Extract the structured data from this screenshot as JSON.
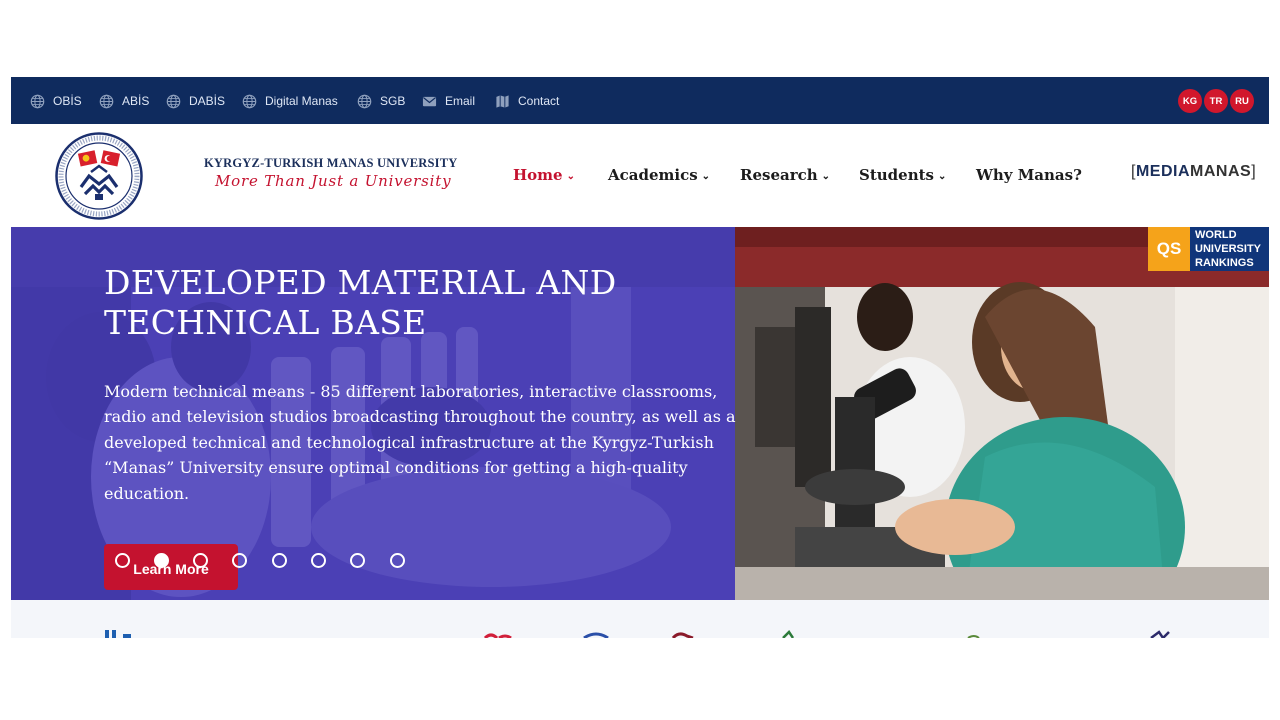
{
  "topbar": {
    "links": [
      {
        "label": "OBİS",
        "icon": "globe-icon"
      },
      {
        "label": "ABİS",
        "icon": "globe-icon"
      },
      {
        "label": "DABİS",
        "icon": "globe-icon"
      },
      {
        "label": "Digital Manas",
        "icon": "globe-icon"
      },
      {
        "label": "SGB",
        "icon": "globe-icon"
      },
      {
        "label": "Email",
        "icon": "envelope-icon"
      },
      {
        "label": "Contact",
        "icon": "map-icon"
      }
    ],
    "languages": [
      "KG",
      "TR",
      "RU"
    ]
  },
  "header": {
    "university_name": "KYRGYZ-TURKISH MANAS UNIVERSITY",
    "slogan": "More Than Just a University",
    "nav": [
      {
        "label": "Home",
        "active": true,
        "dropdown": true
      },
      {
        "label": "Academics",
        "active": false,
        "dropdown": true
      },
      {
        "label": "Research",
        "active": false,
        "dropdown": true
      },
      {
        "label": "Students",
        "active": false,
        "dropdown": true
      },
      {
        "label": "Why Manas?",
        "active": false,
        "dropdown": false
      }
    ],
    "media_logo": {
      "part1": "MEDIA",
      "part2": "MANAS"
    }
  },
  "hero": {
    "title": "DEVELOPED MATERIAL AND TECHNICAL BASE",
    "text": "Modern technical means - 85 different laboratories, interactive classrooms, radio and television studios broadcasting throughout the country, as well as a developed technical and technological infrastructure at the Kyrgyz-Turkish “Manas” University ensure optimal conditions for getting a high-quality education.",
    "button_label": "Learn More",
    "slide_count": 8,
    "active_slide": 2
  },
  "qs_badge": {
    "short": "QS",
    "line1": "WORLD",
    "line2": "UNIVERSITY",
    "line3": "RANKINGS"
  },
  "colors": {
    "topbar_bg": "#0f2b5e",
    "accent_red": "#c4122f",
    "hero_overlay": "#4a3fb4",
    "qs_orange": "#f5a31a",
    "qs_blue": "#10357a"
  }
}
